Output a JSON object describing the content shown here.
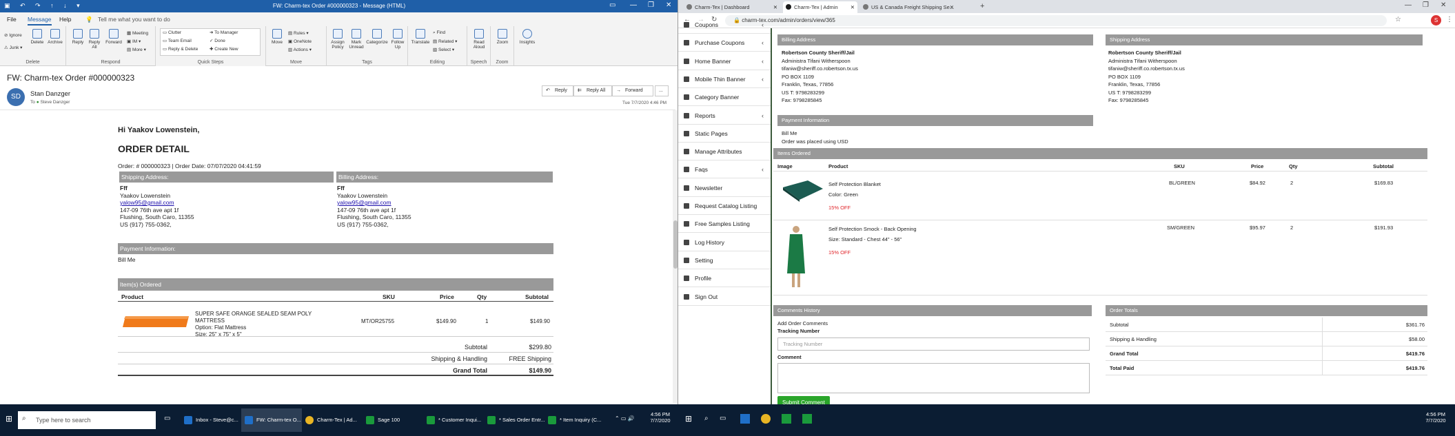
{
  "outlook": {
    "window_title": "FW: Charm-tex Order #000000323 - Message (HTML)",
    "menu": {
      "file": "File",
      "message": "Message",
      "help": "Help",
      "tellme": "Tell me what you want to do"
    },
    "ribbon": {
      "delete_group": {
        "label": "Delete",
        "ignore": "Ignore",
        "junk": "Junk",
        "delete": "Delete",
        "archive": "Archive"
      },
      "respond_group": {
        "label": "Respond",
        "reply": "Reply",
        "reply_all": "Reply All",
        "forward": "Forward",
        "meeting": "Meeting",
        "im": "IM",
        "more": "More"
      },
      "quick_steps": {
        "label": "Quick Steps",
        "items": [
          "Clutter",
          "Team Email",
          "Reply & Delete",
          "To Manager",
          "Done",
          "Create New"
        ]
      },
      "move_group": {
        "label": "Move",
        "move": "Move",
        "rules": "Rules",
        "onenote": "OneNote",
        "actions": "Actions"
      },
      "tags_group": {
        "label": "Tags",
        "assign_policy": "Assign Policy",
        "mark_unread": "Mark Unread",
        "categorize": "Categorize",
        "follow_up": "Follow Up"
      },
      "editing_group": {
        "label": "Editing",
        "translate": "Translate",
        "find": "Find",
        "related": "Related",
        "select": "Select"
      },
      "speech_group": {
        "label": "Speech",
        "read_aloud": "Read Aloud"
      },
      "zoom_group": {
        "label": "Zoom",
        "zoom": "Zoom"
      },
      "insights": "Insights"
    },
    "message": {
      "subject": "FW: Charm-tex Order #000000323",
      "avatar": "SD",
      "sender": "Stan Danzger",
      "to_label": "To",
      "to": "Steve Danzger",
      "date": "Tue 7/7/2020 4:46 PM",
      "actions": {
        "reply": "Reply",
        "reply_all": "Reply All",
        "forward": "Forward",
        "more": "..."
      }
    },
    "email": {
      "greeting": "Hi Yaakov Lowenstein,",
      "heading": "ORDER DETAIL",
      "order_line": "Order: # 000000323 | Order Date: 07/07/2020 04:41:59",
      "shipping_label": "Shipping Address:",
      "billing_label": "Billing Address:",
      "shipping": [
        "Fff",
        "Yaakov Lowenstein",
        "yalow95@gmail.com",
        "147-09 76th ave apt 1f",
        "Flushing, South Caro, 11355",
        "US (917) 755-0362,"
      ],
      "billing": [
        "Fff",
        "Yaakov Lowenstein",
        "yalow95@gmail.com",
        "147-09 76th ave apt 1f",
        "Flushing, South Caro, 11355",
        "US (917) 755-0362,"
      ],
      "payment_label": "Payment Information:",
      "payment": "Bill Me",
      "items_label": "Item(s) Ordered",
      "cols": {
        "product": "Product",
        "sku": "SKU",
        "price": "Price",
        "qty": "Qty",
        "subtotal": "Subtotal"
      },
      "item": {
        "name": "SUPER SAFE ORANGE SEALED SEAM POLY MATTRESS",
        "option": "Option: Flat Mattress",
        "size": "Size: 25\" x 75\" x 5\"",
        "sku": "MT/OR25755",
        "price": "$149.90",
        "qty": "1",
        "subtotal": "$149.90"
      },
      "totals": [
        {
          "label": "Subtotal",
          "value": "$299.80"
        },
        {
          "label": "Shipping & Handling",
          "value": "FREE Shipping"
        },
        {
          "label": "Grand Total",
          "value": "$149.90"
        }
      ]
    }
  },
  "taskbar": {
    "search": "Type here to search",
    "apps": [
      "Inbox - Steve@c...",
      "FW: Charm-tex O...",
      "Charm-Tex | Ad...",
      "Sage 100",
      "* Customer Inqui...",
      "* Sales Order Entr...",
      "* Item Inquiry (C..."
    ],
    "time_left": "4:56 PM",
    "date_left": "7/7/2020",
    "time_right": "4:56 PM",
    "date_right": "7/7/2020"
  },
  "browser": {
    "tabs": [
      "Charm-Tex | Dashboard",
      "Charm-Tex | Admin",
      "US & Canada Freight Shipping Se..."
    ],
    "url": "charm-tex.com/admin/orders/view/365",
    "avatar": "S"
  },
  "sidebar": [
    {
      "label": "Coupons",
      "chev": true
    },
    {
      "label": "Purchase Coupons",
      "chev": true
    },
    {
      "label": "Home Banner",
      "chev": true
    },
    {
      "label": "Mobile Thin Banner",
      "chev": true
    },
    {
      "label": "Category Banner",
      "chev": false
    },
    {
      "label": "Reports",
      "chev": true
    },
    {
      "label": "Static Pages",
      "chev": false
    },
    {
      "label": "Manage Attributes",
      "chev": false
    },
    {
      "label": "Faqs",
      "chev": true
    },
    {
      "label": "Newsletter",
      "chev": false
    },
    {
      "label": "Request Catalog Listing",
      "chev": false
    },
    {
      "label": "Free Samples Listing",
      "chev": false
    },
    {
      "label": "Log History",
      "chev": false
    },
    {
      "label": "Setting",
      "chev": false
    },
    {
      "label": "Profile",
      "chev": false
    },
    {
      "label": "Sign Out",
      "chev": false
    }
  ],
  "admin": {
    "billing_label": "Billing Address",
    "shipping_label": "Shipping Address",
    "billing": [
      "Robertson County Sheriff/Jail",
      "Administra Tifani Witherspoon",
      "tifaniw@sheriff.co.robertson.tx.us",
      "PO BOX 1109",
      "Franklin, Texas, 77856",
      "US T: 9798283299",
      "Fax: 9798285845"
    ],
    "shipping": [
      "Robertson County Sheriff/Jail",
      "Administra Tifani Witherspoon",
      "tifaniw@sheriff.co.robertson.tx.us",
      "PO BOX 1109",
      "Franklin, Texas, 77856",
      "US T: 9798283299",
      "Fax: 9798285845"
    ],
    "payment_label": "Payment Information",
    "payment": [
      "Bill Me",
      "Order was placed using USD"
    ],
    "items_label": "Items Ordered",
    "cols": {
      "image": "Image",
      "product": "Product",
      "sku": "SKU",
      "price": "Price",
      "qty": "Qty",
      "subtotal": "Subtotal"
    },
    "items": [
      {
        "name": "Self Protection Blanket",
        "option": "Color: Green",
        "discount": "15% OFF",
        "sku": "BL/GREEN",
        "price": "$84.92",
        "qty": "2",
        "subtotal": "$169.83"
      },
      {
        "name": "Self Protection Smock - Back Opening",
        "option": "Size: Standard - Chest 44\" - 56\"",
        "discount": "15% OFF",
        "sku": "SM/GREEN",
        "price": "$95.97",
        "qty": "2",
        "subtotal": "$191.93"
      }
    ],
    "comments_label": "Comments History",
    "add_comments": "Add Order Comments",
    "tracking_label": "Tracking Number",
    "tracking_placeholder": "Tracking Number",
    "comment_label": "Comment",
    "submit": "Submit Comment",
    "totals_label": "Order Totals",
    "totals": [
      {
        "label": "Subtotal",
        "value": "$361.76",
        "bold": false
      },
      {
        "label": "Shipping & Handling",
        "value": "$58.00",
        "bold": false
      },
      {
        "label": "Grand Total",
        "value": "$419.76",
        "bold": true
      },
      {
        "label": "Total Paid",
        "value": "$419.76",
        "bold": true
      }
    ]
  },
  "colors": {
    "outlook_blue": "#1f5fa8",
    "grey_header": "#999999",
    "green": "#2aa52a",
    "discount_red": "#e0262b"
  }
}
